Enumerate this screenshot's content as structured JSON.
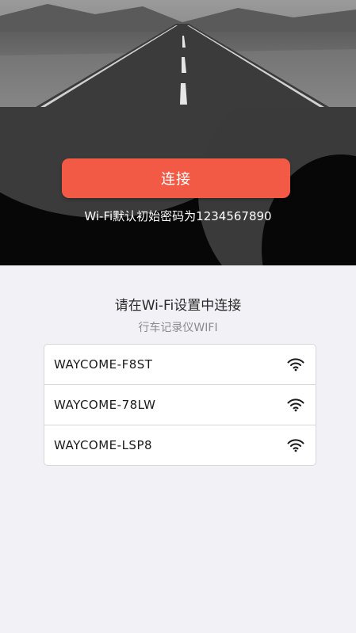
{
  "connect": {
    "label": "连接"
  },
  "password_hint": "Wi-Fi默认初始密码为1234567890",
  "section": {
    "title": "请在Wi-Fi设置中连接",
    "subtitle": "行车记录仪WIFI"
  },
  "networks": [
    {
      "ssid": "WAYCOME-F8ST",
      "icon": "wifi-icon"
    },
    {
      "ssid": "WAYCOME-78LW",
      "icon": "wifi-icon"
    },
    {
      "ssid": "WAYCOME-LSP8",
      "icon": "wifi-icon"
    }
  ],
  "colors": {
    "accent": "#f25a45",
    "panel": "#070707",
    "background": "#f1f1f6"
  }
}
